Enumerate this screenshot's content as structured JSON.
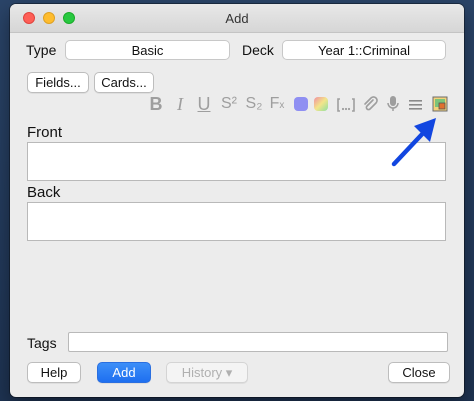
{
  "window": {
    "title": "Add"
  },
  "type": {
    "label": "Type",
    "value": "Basic"
  },
  "deck": {
    "label": "Deck",
    "value": "Year 1::Criminal"
  },
  "buttons": {
    "fields": "Fields...",
    "cards": "Cards..."
  },
  "toolbar": {
    "bold": "B",
    "italic": "I",
    "underline": "U",
    "superscript": "S²",
    "subscript": "S₂",
    "clear_format": "F"
  },
  "editor": {
    "front_label": "Front",
    "back_label": "Back"
  },
  "tags": {
    "label": "Tags",
    "value": ""
  },
  "footer": {
    "help": "Help",
    "add": "Add",
    "history": "History ▾",
    "close": "Close"
  },
  "colors": {
    "accent": "#1e6ff0",
    "arrow": "#1246e0"
  }
}
